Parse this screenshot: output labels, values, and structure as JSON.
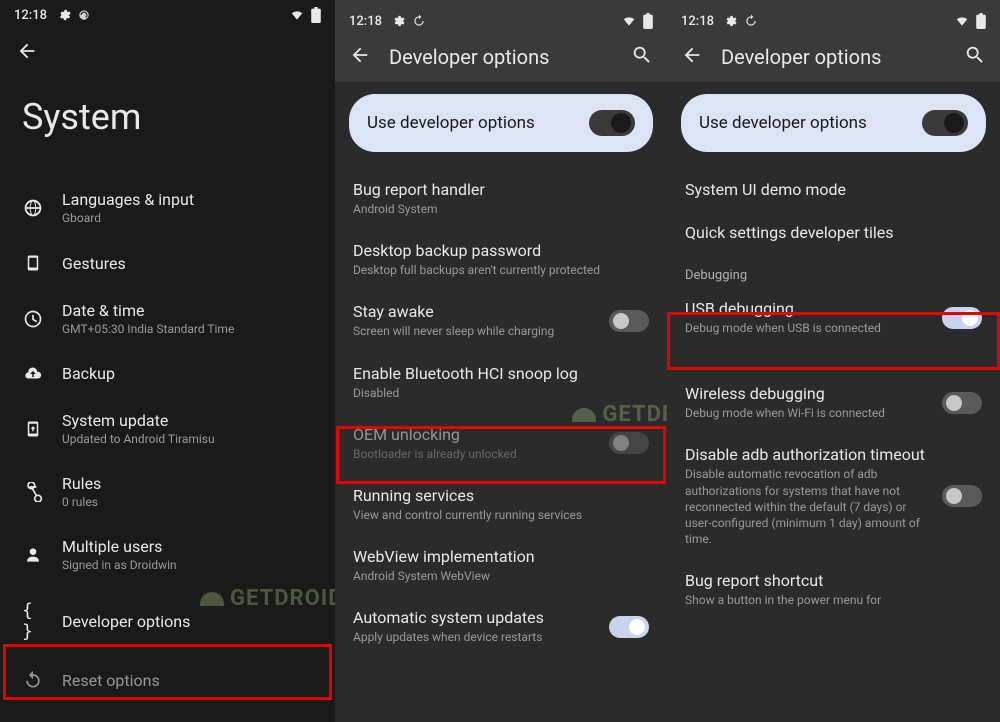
{
  "statusbar": {
    "time": "12:18"
  },
  "left": {
    "title": "System",
    "items": [
      {
        "title": "Languages & input",
        "sub": "Gboard"
      },
      {
        "title": "Gestures",
        "sub": ""
      },
      {
        "title": "Date & time",
        "sub": "GMT+05:30 India Standard Time"
      },
      {
        "title": "Backup",
        "sub": ""
      },
      {
        "title": "System update",
        "sub": "Updated to Android Tiramisu"
      },
      {
        "title": "Rules",
        "sub": "0 rules"
      },
      {
        "title": "Multiple users",
        "sub": "Signed in as Droidwin"
      },
      {
        "title": "Developer options",
        "sub": ""
      },
      {
        "title": "Reset options",
        "sub": ""
      }
    ]
  },
  "mid": {
    "header": "Developer options",
    "master_toggle": "Use developer options",
    "items": [
      {
        "title": "Bug report handler",
        "sub": "Android System"
      },
      {
        "title": "Desktop backup password",
        "sub": "Desktop full backups aren't currently protected"
      },
      {
        "title": "Stay awake",
        "sub": "Screen will never sleep while charging",
        "switch": "off"
      },
      {
        "title": "Enable Bluetooth HCI snoop log",
        "sub": "Disabled"
      },
      {
        "title": "OEM unlocking",
        "sub": "Bootloader is already unlocked",
        "switch": "off",
        "dim": true
      },
      {
        "title": "Running services",
        "sub": "View and control currently running services"
      },
      {
        "title": "WebView implementation",
        "sub": "Android System WebView"
      },
      {
        "title": "Automatic system updates",
        "sub": "Apply updates when device restarts",
        "switch": "on"
      }
    ]
  },
  "right": {
    "header": "Developer options",
    "master_toggle": "Use developer options",
    "items_a": [
      {
        "title": "System UI demo mode"
      },
      {
        "title": "Quick settings developer tiles"
      }
    ],
    "section": "Debugging",
    "items_b": [
      {
        "title": "USB debugging",
        "sub": "Debug mode when USB is connected",
        "switch": "on"
      },
      {
        "title": "Wireless debugging",
        "sub": "Debug mode when Wi-Fi is connected",
        "switch": "off"
      },
      {
        "title": "Disable adb authorization timeout",
        "sub": "Disable automatic revocation of adb authorizations for systems that have not reconnected within the default (7 days) or user-configured (minimum 1 day) amount of time.",
        "switch": "off"
      },
      {
        "title": "Bug report shortcut",
        "sub": "Show a button in the power menu for"
      }
    ]
  },
  "watermark": "GETDROIDTIPS"
}
